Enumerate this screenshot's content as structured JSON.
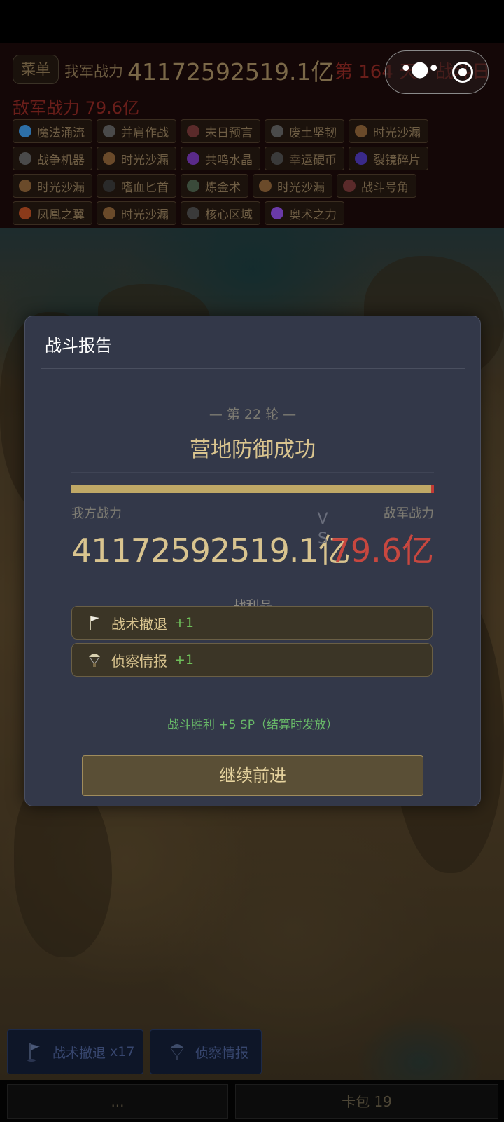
{
  "header": {
    "menu_label": "菜单",
    "my_power_label": "我军战力",
    "my_power_value": "41172592519.1亿",
    "day_label": "第 164 天 - 战斗日",
    "enemy_power": "敌军战力 79.6亿",
    "tag_rows": [
      [
        {
          "label": "魔法涌流",
          "icon": "magic-orb-icon",
          "color": "#2d6fa8"
        },
        {
          "label": "并肩作战",
          "icon": "helmet-icon",
          "color": "#4a4a4a"
        },
        {
          "label": "末日预言",
          "icon": "doom-icon",
          "color": "#5a2a2a"
        },
        {
          "label": "废土坚韧",
          "icon": "shield-icon",
          "color": "#4a4a4a"
        },
        {
          "label": "时光沙漏",
          "icon": "hourglass-icon",
          "color": "#6a4a2a"
        }
      ],
      [
        {
          "label": "战争机器",
          "icon": "gear-icon",
          "color": "#4a4a4a"
        },
        {
          "label": "时光沙漏",
          "icon": "hourglass-icon",
          "color": "#6a4a2a"
        },
        {
          "label": "共鸣水晶",
          "icon": "crystal-icon",
          "color": "#5a2a8a"
        },
        {
          "label": "幸运硬币",
          "icon": "coin-icon",
          "color": "#3a3a3a"
        },
        {
          "label": "裂镜碎片",
          "icon": "mirror-shard-icon",
          "color": "#3a2a8a"
        }
      ],
      [
        {
          "label": "时光沙漏",
          "icon": "hourglass-icon",
          "color": "#6a4a2a"
        },
        {
          "label": "嗜血匕首",
          "icon": "dagger-icon",
          "color": "#2a2a2a"
        },
        {
          "label": "炼金术",
          "icon": "flask-icon",
          "color": "#3a4a3a"
        },
        {
          "label": "时光沙漏",
          "icon": "hourglass-icon",
          "color": "#6a4a2a"
        },
        {
          "label": "战斗号角",
          "icon": "horn-icon",
          "color": "#5a2a2a"
        }
      ],
      [
        {
          "label": "凤凰之翼",
          "icon": "phoenix-wing-icon",
          "color": "#8a3a1a"
        },
        {
          "label": "时光沙漏",
          "icon": "hourglass-icon",
          "color": "#6a4a2a"
        },
        {
          "label": "核心区域",
          "icon": "core-icon",
          "color": "#3a3a3a"
        },
        {
          "label": "奥术之力",
          "icon": "arcane-icon",
          "color": "#6a3aa8"
        }
      ]
    ]
  },
  "modal": {
    "title": "战斗报告",
    "round": "— 第 22 轮 —",
    "result": "营地防御成功",
    "my_power_fraction": 0.992,
    "my_label": "我方战力",
    "enemy_label": "敌军战力",
    "my_value": "41172592519.1亿",
    "vs_v": "V",
    "vs_s": "S",
    "enemy_value": "79.6亿",
    "loot_title": "— 战利品 —",
    "loot": [
      {
        "name": "战术撤退",
        "count": "+1",
        "icon": "white-flag-icon"
      },
      {
        "name": "侦察情报",
        "count": "+1",
        "icon": "parachute-icon"
      }
    ],
    "victory_text": "战斗胜利 +5 SP（结算时发放）",
    "continue_label": "继续前进"
  },
  "bottom": {
    "cards": [
      {
        "name": "战术撤退",
        "count": "x17",
        "icon": "white-flag-icon"
      },
      {
        "name": "侦察情报",
        "count": "",
        "icon": "parachute-icon"
      }
    ],
    "left_btn": "...",
    "bag_btn": "卡包 19"
  }
}
